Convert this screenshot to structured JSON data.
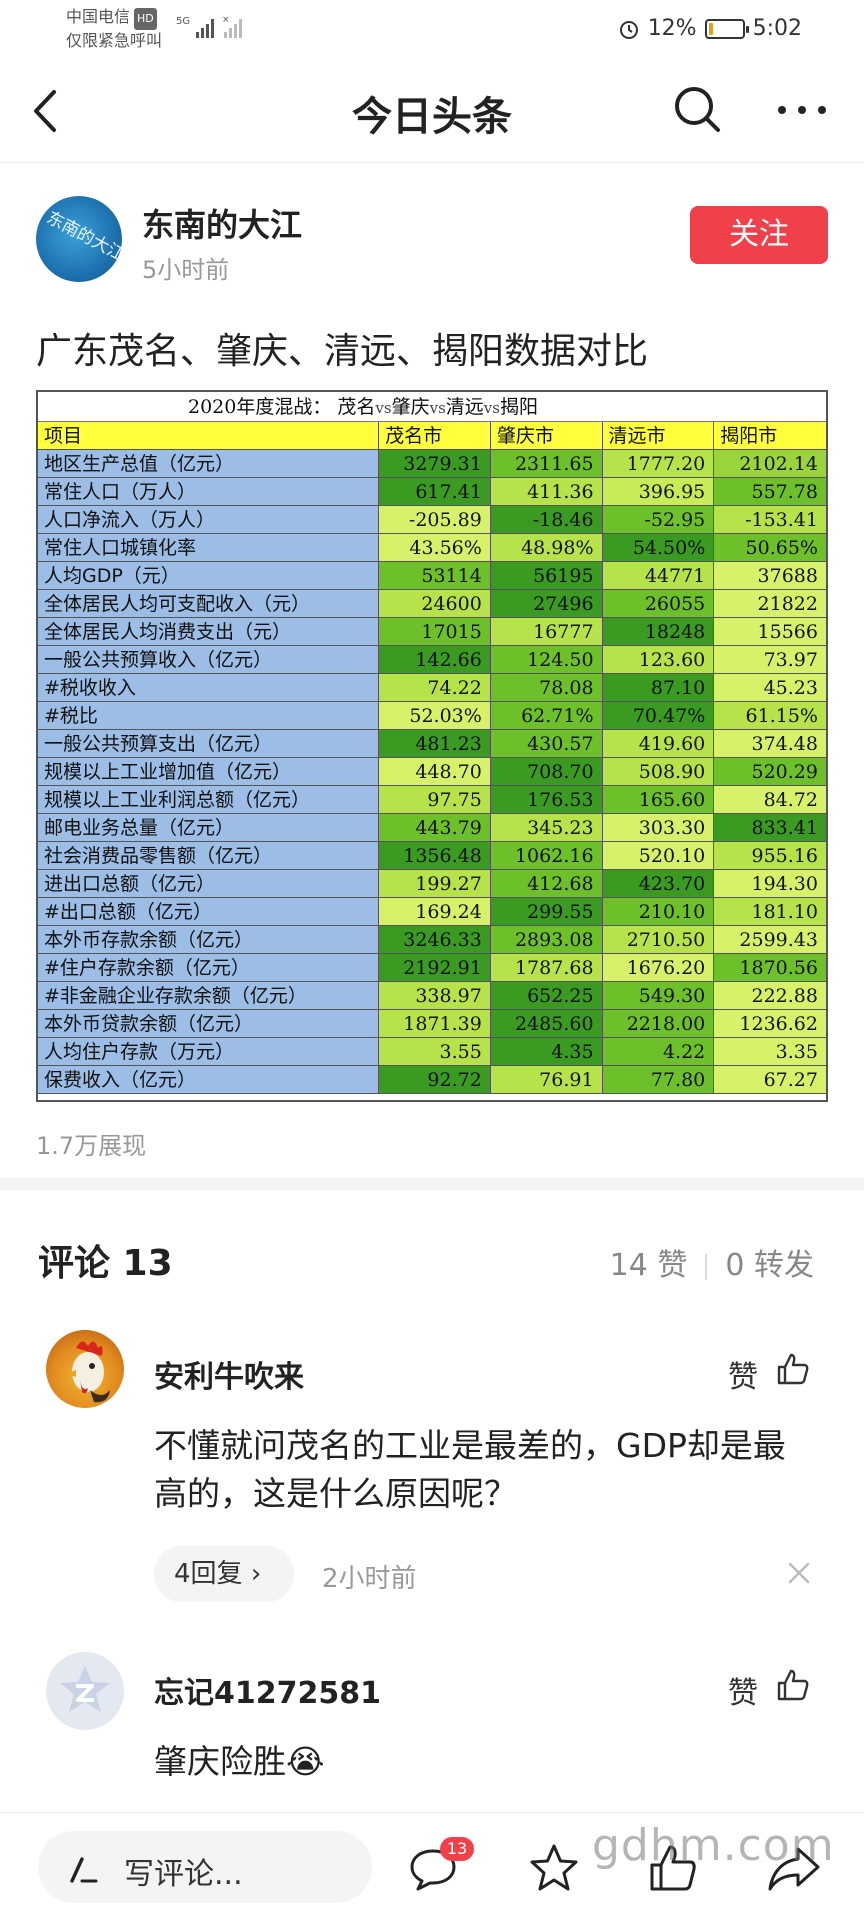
{
  "status_bar": {
    "carrier": "中国电信",
    "hd": "HD",
    "emergency": "仅限紧急呼叫",
    "network": "5G",
    "battery": "12%",
    "battery_level": 0.12,
    "time": "5:02"
  },
  "nav": {
    "title": "今日头条"
  },
  "author": {
    "name": "东南的大江",
    "time": "5小时前",
    "follow_label": "关注",
    "avatar_text": "东南的大江"
  },
  "post": {
    "title": "广东茂名、肇庆、清远、揭阳数据对比",
    "views": "1.7万展现"
  },
  "table": {
    "title": "2020年度混战：",
    "cities_line": [
      "茂名",
      "vs",
      "肇庆",
      "vs",
      "清远",
      "vs",
      "揭阳"
    ],
    "headers": [
      "项目",
      "茂名市",
      "肇庆市",
      "清远市",
      "揭阳市"
    ],
    "rows": [
      {
        "item": "地区生产总值（亿元）",
        "values": [
          "3279.31",
          "2311.65",
          "1777.20",
          "2102.14"
        ],
        "colors": [
          "#3a9a22",
          "#6dc02a",
          "#b6e24a",
          "#9ad43c"
        ]
      },
      {
        "item": "常住人口（万人）",
        "values": [
          "617.41",
          "411.36",
          "396.95",
          "557.78"
        ],
        "colors": [
          "#3a9a22",
          "#b6e24a",
          "#c8ec58",
          "#6dc02a"
        ]
      },
      {
        "item": "人口净流入（万人）",
        "values": [
          "-205.89",
          "-18.46",
          "-52.95",
          "-153.41"
        ],
        "colors": [
          "#d7f26a",
          "#3a9a22",
          "#6dc02a",
          "#b6e24a"
        ]
      },
      {
        "item": "常住人口城镇化率",
        "values": [
          "43.56%",
          "48.98%",
          "54.50%",
          "50.65%"
        ],
        "colors": [
          "#d7f26a",
          "#b6e24a",
          "#3a9a22",
          "#6dc02a"
        ]
      },
      {
        "item": "人均GDP（元）",
        "values": [
          "53114",
          "56195",
          "44771",
          "37688"
        ],
        "colors": [
          "#6dc02a",
          "#3a9a22",
          "#b6e24a",
          "#d7f26a"
        ]
      },
      {
        "item": "全体居民人均可支配收入（元）",
        "values": [
          "24600",
          "27496",
          "26055",
          "21822"
        ],
        "colors": [
          "#b6e24a",
          "#3a9a22",
          "#6dc02a",
          "#d7f26a"
        ]
      },
      {
        "item": "全体居民人均消费支出（元）",
        "values": [
          "17015",
          "16777",
          "18248",
          "15566"
        ],
        "colors": [
          "#6dc02a",
          "#b6e24a",
          "#3a9a22",
          "#d7f26a"
        ]
      },
      {
        "item": "一般公共预算收入（亿元）",
        "values": [
          "142.66",
          "124.50",
          "123.60",
          "73.97"
        ],
        "colors": [
          "#3a9a22",
          "#6dc02a",
          "#b6e24a",
          "#d7f26a"
        ]
      },
      {
        "item": "#税收收入",
        "values": [
          "74.22",
          "78.08",
          "87.10",
          "45.23"
        ],
        "colors": [
          "#b6e24a",
          "#6dc02a",
          "#3a9a22",
          "#d7f26a"
        ]
      },
      {
        "item": "#税比",
        "values": [
          "52.03%",
          "62.71%",
          "70.47%",
          "61.15%"
        ],
        "colors": [
          "#d7f26a",
          "#6dc02a",
          "#3a9a22",
          "#b6e24a"
        ]
      },
      {
        "item": "一般公共预算支出（亿元）",
        "values": [
          "481.23",
          "430.57",
          "419.60",
          "374.48"
        ],
        "colors": [
          "#3a9a22",
          "#6dc02a",
          "#b6e24a",
          "#d7f26a"
        ]
      },
      {
        "item": "规模以上工业增加值（亿元）",
        "values": [
          "448.70",
          "708.70",
          "508.90",
          "520.29"
        ],
        "colors": [
          "#d7f26a",
          "#3a9a22",
          "#b6e24a",
          "#6dc02a"
        ]
      },
      {
        "item": "规模以上工业利润总额（亿元）",
        "values": [
          "97.75",
          "176.53",
          "165.60",
          "84.72"
        ],
        "colors": [
          "#b6e24a",
          "#3a9a22",
          "#6dc02a",
          "#d7f26a"
        ]
      },
      {
        "item": "邮电业务总量（亿元）",
        "values": [
          "443.79",
          "345.23",
          "303.30",
          "833.41"
        ],
        "colors": [
          "#6dc02a",
          "#b6e24a",
          "#d7f26a",
          "#3a9a22"
        ]
      },
      {
        "item": "社会消费品零售额（亿元）",
        "values": [
          "1356.48",
          "1062.16",
          "520.10",
          "955.16"
        ],
        "colors": [
          "#3a9a22",
          "#6dc02a",
          "#d7f26a",
          "#b6e24a"
        ]
      },
      {
        "item": "进出口总额（亿元）",
        "values": [
          "199.27",
          "412.68",
          "423.70",
          "194.30"
        ],
        "colors": [
          "#b6e24a",
          "#6dc02a",
          "#3a9a22",
          "#d7f26a"
        ]
      },
      {
        "item": "#出口总额（亿元）",
        "values": [
          "169.24",
          "299.55",
          "210.10",
          "181.10"
        ],
        "colors": [
          "#d7f26a",
          "#3a9a22",
          "#6dc02a",
          "#b6e24a"
        ]
      },
      {
        "item": "本外币存款余额（亿元）",
        "values": [
          "3246.33",
          "2893.08",
          "2710.50",
          "2599.43"
        ],
        "colors": [
          "#3a9a22",
          "#6dc02a",
          "#b6e24a",
          "#d7f26a"
        ]
      },
      {
        "item": "#住户存款余额（亿元）",
        "values": [
          "2192.91",
          "1787.68",
          "1676.20",
          "1870.56"
        ],
        "colors": [
          "#3a9a22",
          "#b6e24a",
          "#d7f26a",
          "#6dc02a"
        ]
      },
      {
        "item": "#非金融企业存款余额（亿元）",
        "values": [
          "338.97",
          "652.25",
          "549.30",
          "222.88"
        ],
        "colors": [
          "#b6e24a",
          "#3a9a22",
          "#6dc02a",
          "#d7f26a"
        ]
      },
      {
        "item": "本外币贷款余额（亿元）",
        "values": [
          "1871.39",
          "2485.60",
          "2218.00",
          "1236.62"
        ],
        "colors": [
          "#b6e24a",
          "#3a9a22",
          "#6dc02a",
          "#d7f26a"
        ]
      },
      {
        "item": "人均住户存款（万元）",
        "values": [
          "3.55",
          "4.35",
          "4.22",
          "3.35"
        ],
        "colors": [
          "#b6e24a",
          "#3a9a22",
          "#6dc02a",
          "#d7f26a"
        ]
      },
      {
        "item": "保费收入（亿元）",
        "values": [
          "92.72",
          "76.91",
          "77.80",
          "67.27"
        ],
        "colors": [
          "#3a9a22",
          "#b6e24a",
          "#6dc02a",
          "#d7f26a"
        ]
      }
    ]
  },
  "comments_section": {
    "title": "评论 13",
    "likes": "14 赞",
    "shares": "0 转发"
  },
  "comments": [
    {
      "user": "安利牛吹来",
      "like_label": "赞",
      "text": "不懂就问茂名的工业是最差的，GDP却是最高的，这是什么原因呢？",
      "replies": "4回复",
      "time": "2小时前"
    },
    {
      "user": "忘记41272581",
      "like_label": "赞",
      "text": "肇庆险胜😭"
    }
  ],
  "bottom_bar": {
    "write_label": "写评论...",
    "comment_badge": "13",
    "watermark": "gdhm.com"
  },
  "icons": {
    "back": "back-arrow-icon",
    "search": "search-icon",
    "more": "more-icon",
    "like": "thumbs-up-icon",
    "close": "close-icon",
    "pen": "pen-icon",
    "comment": "comment-bubble-icon",
    "star": "star-icon",
    "share": "share-icon"
  },
  "colors": {
    "accent_red": "#f0414b",
    "header_yellow": "#ffff3c",
    "item_blue": "#9bbde6"
  }
}
